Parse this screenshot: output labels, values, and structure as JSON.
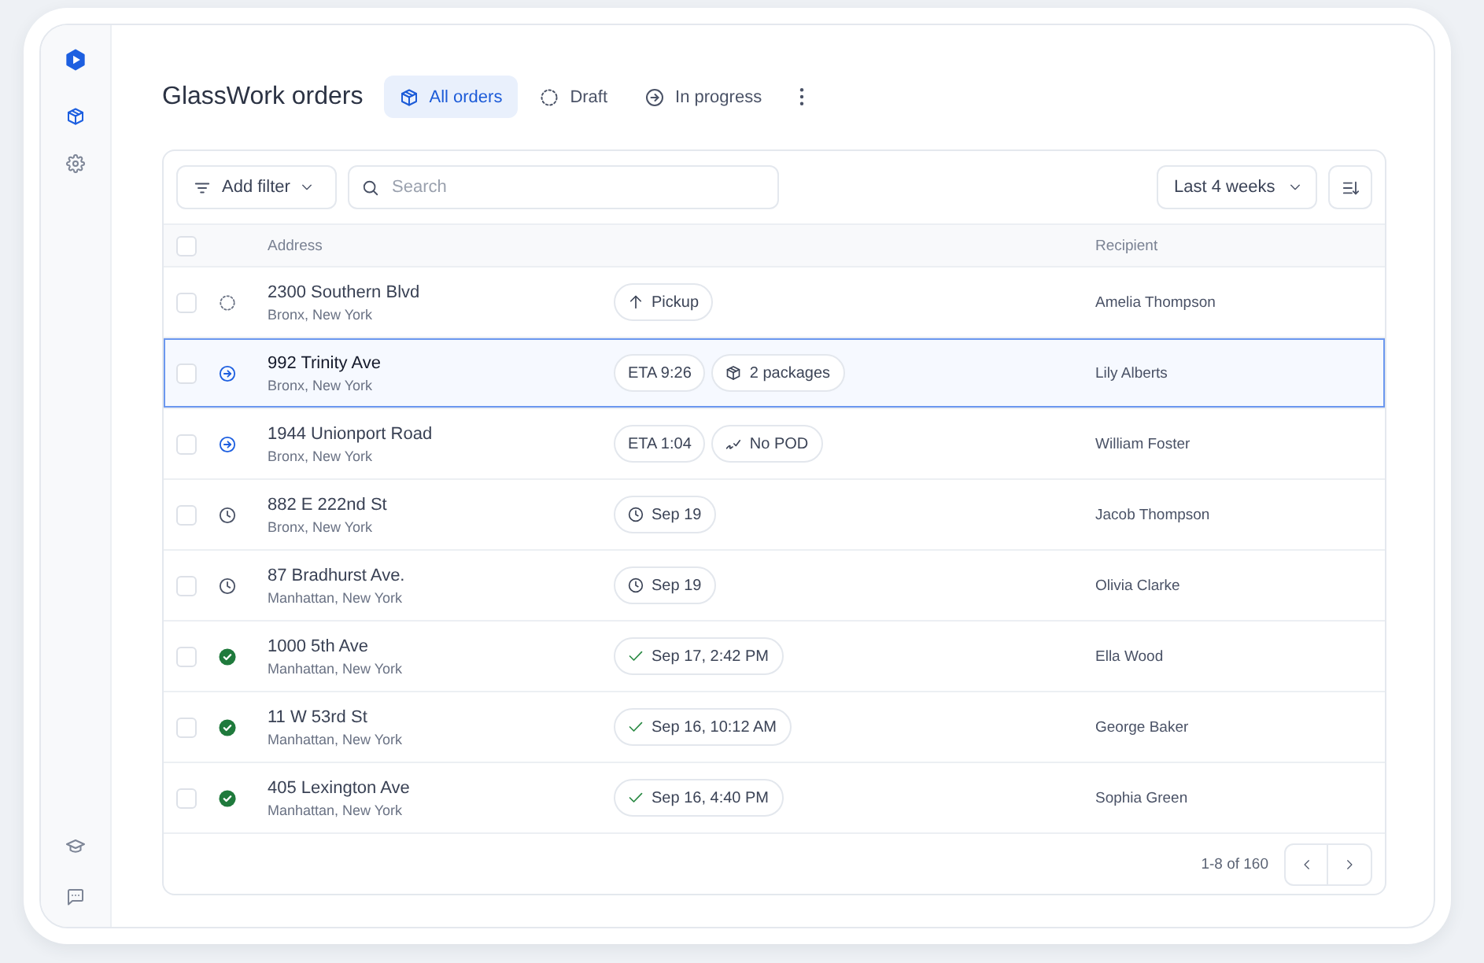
{
  "sidebar": {
    "items": [
      {
        "kind": "box",
        "selected": true
      },
      {
        "kind": "gear",
        "selected": false
      }
    ],
    "bottom_items": [
      {
        "kind": "cap",
        "selected": false
      },
      {
        "kind": "chat",
        "selected": false
      }
    ]
  },
  "header": {
    "title": "GlassWork orders",
    "tabs": [
      {
        "label": "All orders",
        "kind": "box",
        "selected": true
      },
      {
        "label": "Draft",
        "kind": "draft",
        "selected": false
      },
      {
        "label": "In progress",
        "kind": "in_progress",
        "selected": false
      }
    ]
  },
  "toolbar": {
    "filter_button": "Add filter",
    "search": {
      "placeholder": "Search"
    },
    "period": "Last 4 weeks"
  },
  "table": {
    "header_checkbox": {
      "checked": false
    },
    "columns": [
      {
        "label": "Address"
      },
      {
        "label": "Recipient"
      }
    ],
    "rows": [
      {
        "selected": false,
        "checked": false,
        "status": {
          "kind": "draft"
        },
        "street": "2300 Southern Blvd",
        "city": "Bronx, New York",
        "tags": [
          {
            "kind": "pickup",
            "label": "Pickup"
          }
        ],
        "recipient": "Amelia Thompson"
      },
      {
        "selected": true,
        "checked": false,
        "status": {
          "kind": "in_progress"
        },
        "street": "992 Trinity Ave",
        "city": "Bronx, New York",
        "tags": [
          {
            "kind": "eta",
            "label": "ETA 9:26"
          },
          {
            "kind": "packages",
            "label": "2 packages"
          }
        ],
        "recipient": "Lily Alberts"
      },
      {
        "selected": false,
        "checked": false,
        "status": {
          "kind": "in_progress"
        },
        "street": "1944 Unionport Road",
        "city": "Bronx, New York",
        "tags": [
          {
            "kind": "eta",
            "label": "ETA 1:04"
          },
          {
            "kind": "no_pod",
            "label": "No POD"
          }
        ],
        "recipient": "William Foster"
      },
      {
        "selected": false,
        "checked": false,
        "status": {
          "kind": "scheduled"
        },
        "street": "882 E 222nd St",
        "city": "Bronx, New York",
        "tags": [
          {
            "kind": "date",
            "label": "Sep 19"
          }
        ],
        "recipient": "Jacob Thompson"
      },
      {
        "selected": false,
        "checked": false,
        "status": {
          "kind": "scheduled"
        },
        "street": "87 Bradhurst Ave.",
        "city": "Manhattan, New York",
        "tags": [
          {
            "kind": "date",
            "label": "Sep 19"
          }
        ],
        "recipient": "Olivia Clarke"
      },
      {
        "selected": false,
        "checked": false,
        "status": {
          "kind": "delivered"
        },
        "street": "1000 5th Ave",
        "city": "Manhattan, New York",
        "tags": [
          {
            "kind": "delivered",
            "label": "Sep 17, 2:42 PM"
          }
        ],
        "recipient": "Ella Wood"
      },
      {
        "selected": false,
        "checked": false,
        "status": {
          "kind": "delivered"
        },
        "street": "11 W 53rd St",
        "city": "Manhattan, New York",
        "tags": [
          {
            "kind": "delivered",
            "label": "Sep 16, 10:12 AM"
          }
        ],
        "recipient": "George Baker"
      },
      {
        "selected": false,
        "checked": false,
        "status": {
          "kind": "delivered"
        },
        "street": "405 Lexington Ave",
        "city": "Manhattan, New York",
        "tags": [
          {
            "kind": "delivered",
            "label": "Sep 16, 4:40 PM"
          }
        ],
        "recipient": "Sophia Green"
      }
    ],
    "footer": {
      "range": "1-8 of 160"
    }
  }
}
